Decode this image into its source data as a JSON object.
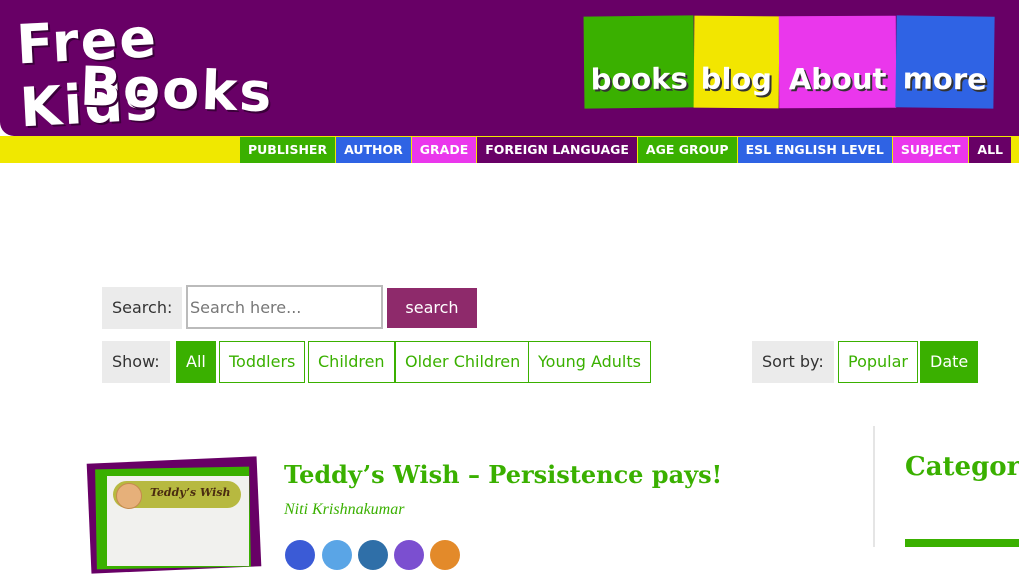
{
  "site": {
    "logo_line1": "Free Kids",
    "logo_line2": "Books"
  },
  "main_nav": [
    "books",
    "blog",
    "About",
    "more"
  ],
  "sub_nav": [
    {
      "label": "PUBLISHER",
      "color": "#3ab000"
    },
    {
      "label": "AUTHOR",
      "color": "#2f63e4"
    },
    {
      "label": "GRADE",
      "color": "#ea37ec"
    },
    {
      "label": "FOREIGN LANGUAGE",
      "color": "#680066"
    },
    {
      "label": "AGE GROUP",
      "color": "#3ab000"
    },
    {
      "label": "ESL ENGLISH LEVEL",
      "color": "#2f63e4"
    },
    {
      "label": "SUBJECT",
      "color": "#ea37ec"
    },
    {
      "label": "ALL",
      "color": "#680066"
    }
  ],
  "search": {
    "label": "Search:",
    "placeholder": "Search here...",
    "button": "search"
  },
  "filters": {
    "show_label": "Show:",
    "options": [
      "All",
      "Toddlers",
      "Children",
      "Older Children",
      "Young Adults"
    ],
    "active": "All"
  },
  "sort": {
    "label": "Sort by:",
    "options": [
      "Popular",
      "Date"
    ],
    "active": "Date"
  },
  "post": {
    "title": "Teddy’s Wish – Persistence pays!",
    "author": "Niti Krishnakumar",
    "thumb_title": "Teddy’s Wish"
  },
  "sidebar": {
    "title": "Categories"
  },
  "colors": {
    "green": "#3ab000",
    "purple": "#680066",
    "yellow": "#f0e800",
    "search_button": "#8e2a6b"
  }
}
